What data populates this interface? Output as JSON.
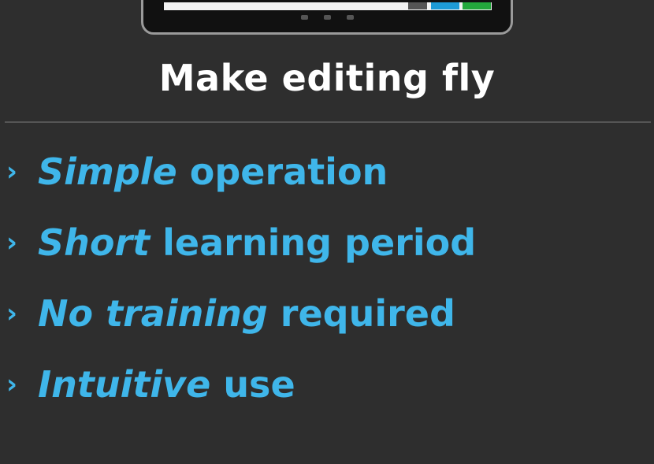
{
  "device": {
    "buttons": [
      {
        "name": "gray",
        "color": "#555555"
      },
      {
        "name": "blue",
        "color": "#1e9bd6"
      },
      {
        "name": "green",
        "color": "#23a83c"
      }
    ]
  },
  "headline": "Make editing fly",
  "features": [
    {
      "bullet": "›",
      "emphasis": "Simple",
      "rest": "operation"
    },
    {
      "bullet": "›",
      "emphasis": "Short",
      "rest": "learning period"
    },
    {
      "bullet": "›",
      "emphasis": "No training",
      "rest": "required"
    },
    {
      "bullet": "›",
      "emphasis": "Intuitive",
      "rest": "use"
    }
  ],
  "colors": {
    "background": "#2e2e2e",
    "headline": "#ffffff",
    "accent": "#3fb6ea",
    "divider": "#555555"
  }
}
